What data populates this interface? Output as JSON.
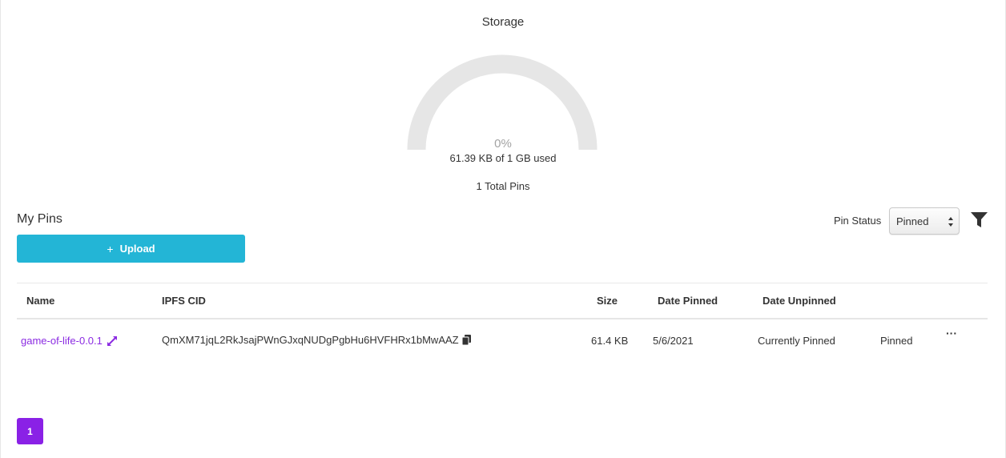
{
  "storage": {
    "title": "Storage",
    "percent_label": "0%",
    "percent_value": 0,
    "used_text": "61.39 KB of 1 GB used",
    "total_pins_text": "1 Total Pins"
  },
  "pins": {
    "section_title": "My Pins",
    "upload_icon": "plus-icon",
    "upload_label": "Upload",
    "filter": {
      "label": "Pin Status",
      "selected": "Pinned",
      "icon": "filter-icon"
    },
    "columns": [
      "Name",
      "IPFS CID",
      "Size",
      "Date Pinned",
      "Date Unpinned"
    ],
    "rows": [
      {
        "name": "game-of-life-0.0.1",
        "cid": "QmXM71jqL2RkJsajPWnGJxqNUDgPgbHu6HVFHRx1bMwAAZ",
        "size": "61.4 KB",
        "date_pinned": "5/6/2021",
        "date_unpinned": "Currently Pinned",
        "status": "Pinned",
        "more": "···"
      }
    ]
  },
  "pagination": {
    "current_page": "1"
  },
  "colors": {
    "accent": "#8a21e6",
    "upload_button": "#23b5d6",
    "gauge_track": "#e6e6e6",
    "link": "#8b2be2"
  }
}
